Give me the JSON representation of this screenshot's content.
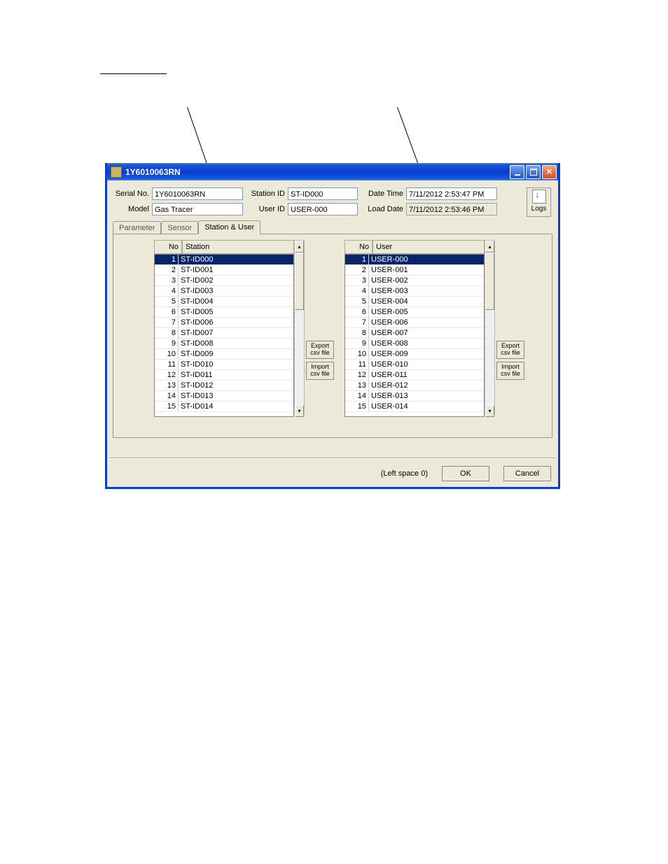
{
  "window": {
    "title": "1Y6010063RN"
  },
  "header": {
    "serial_label": "Serial No.",
    "serial_value": "1Y6010063RN",
    "model_label": "Model",
    "model_value": "Gas Tracer",
    "station_id_label": "Station ID",
    "station_id_value": "ST-ID000",
    "user_id_label": "User ID",
    "user_id_value": "USER-000",
    "datetime_label": "Date Time",
    "datetime_value": "7/11/2012 2:53:47 PM",
    "loaddate_label": "Load Date",
    "loaddate_value": "7/11/2012 2:53:46 PM",
    "logs_label": "Logs"
  },
  "tabs": {
    "parameter": "Parameter",
    "sensor": "Sensor",
    "station_user": "Station & User"
  },
  "station_list": {
    "col_no": "No",
    "col_val": "Station",
    "rows": [
      {
        "no": "1",
        "val": "ST-ID000",
        "sel": true
      },
      {
        "no": "2",
        "val": "ST-ID001"
      },
      {
        "no": "3",
        "val": "ST-ID002"
      },
      {
        "no": "4",
        "val": "ST-ID003"
      },
      {
        "no": "5",
        "val": "ST-ID004"
      },
      {
        "no": "6",
        "val": "ST-ID005"
      },
      {
        "no": "7",
        "val": "ST-ID006"
      },
      {
        "no": "8",
        "val": "ST-ID007"
      },
      {
        "no": "9",
        "val": "ST-ID008"
      },
      {
        "no": "10",
        "val": "ST-ID009"
      },
      {
        "no": "11",
        "val": "ST-ID010"
      },
      {
        "no": "12",
        "val": "ST-ID011"
      },
      {
        "no": "13",
        "val": "ST-ID012"
      },
      {
        "no": "14",
        "val": "ST-ID013"
      },
      {
        "no": "15",
        "val": "ST-ID014"
      }
    ]
  },
  "user_list": {
    "col_no": "No",
    "col_val": "User",
    "rows": [
      {
        "no": "1",
        "val": "USER-000",
        "sel": true
      },
      {
        "no": "2",
        "val": "USER-001"
      },
      {
        "no": "3",
        "val": "USER-002"
      },
      {
        "no": "4",
        "val": "USER-003"
      },
      {
        "no": "5",
        "val": "USER-004"
      },
      {
        "no": "6",
        "val": "USER-005"
      },
      {
        "no": "7",
        "val": "USER-006"
      },
      {
        "no": "8",
        "val": "USER-007"
      },
      {
        "no": "9",
        "val": "USER-008"
      },
      {
        "no": "10",
        "val": "USER-009"
      },
      {
        "no": "11",
        "val": "USER-010"
      },
      {
        "no": "12",
        "val": "USER-011"
      },
      {
        "no": "13",
        "val": "USER-012"
      },
      {
        "no": "14",
        "val": "USER-013"
      },
      {
        "no": "15",
        "val": "USER-014"
      }
    ]
  },
  "csv": {
    "export_l1": "Export",
    "export_l2": "csv file",
    "import_l1": "Import",
    "import_l2": "csv file"
  },
  "footer": {
    "left_space": "(Left space 0)",
    "ok": "OK",
    "cancel": "Cancel"
  }
}
